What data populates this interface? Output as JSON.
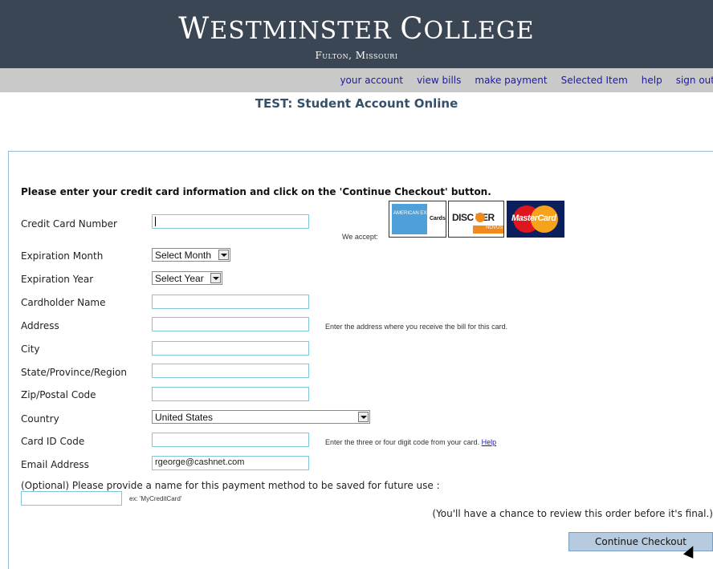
{
  "header": {
    "college_first": "W",
    "college_rest_1": "ESTMINSTER ",
    "college_c": "C",
    "college_rest_2": "OLLEGE",
    "subtitle": "Fulton, Missouri"
  },
  "nav": {
    "items": [
      "your account",
      "view bills",
      "make payment",
      "Selected Item",
      "help",
      "sign out"
    ]
  },
  "page_title": "TEST: Student Account Online",
  "form": {
    "instruction": "Please enter your credit card information and click on the 'Continue Checkout' button.",
    "we_accept": "We accept:",
    "cards": {
      "amex_text": "AMERICAN EXPRESS",
      "amex_label": "Cards",
      "discover": "DISC  VER",
      "discover_sub": "NOVUS",
      "mastercard": "MasterCard"
    },
    "labels": {
      "card_number": "Credit Card Number",
      "exp_month": "Expiration Month",
      "exp_year": "Expiration Year",
      "cardholder": "Cardholder Name",
      "address": "Address",
      "city": "City",
      "state": "State/Province/Region",
      "zip": "Zip/Postal Code",
      "country": "Country",
      "card_id": "Card ID Code",
      "email": "Email Address"
    },
    "values": {
      "exp_month": "Select Month",
      "exp_year": "Select Year",
      "country": "United States",
      "email": "rgeorge@cashnet.com"
    },
    "notes": {
      "address": "Enter the address where you receive the bill for this card.",
      "card_id": "Enter the three or four digit code from your card. ",
      "card_id_link": "Help"
    },
    "optional_label": "(Optional) Please provide a name for this payment method to be saved for future use :",
    "example": "ex: 'MyCreditCard'",
    "review_note": "(You'll have a chance to review this order before it's final.)",
    "continue_button": "Continue Checkout"
  }
}
